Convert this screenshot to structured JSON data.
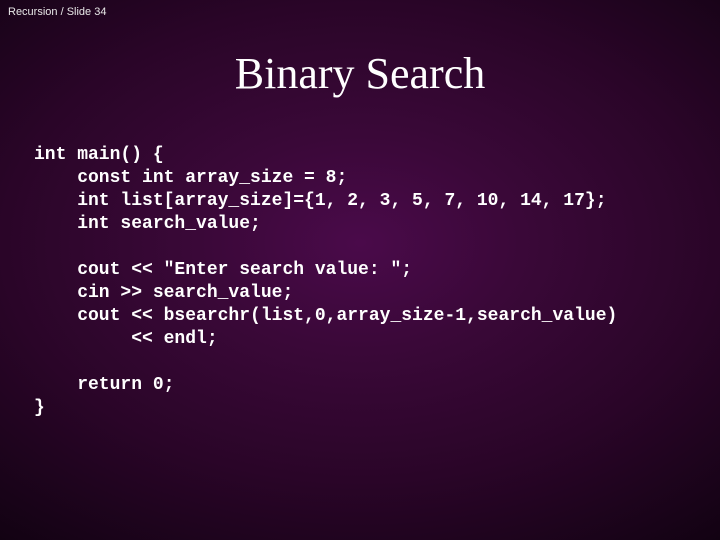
{
  "breadcrumb": "Recursion / Slide 34",
  "title": "Binary Search",
  "code": "int main() {\n    const int array_size = 8;\n    int list[array_size]={1, 2, 3, 5, 7, 10, 14, 17};\n    int search_value;\n\n    cout << \"Enter search value: \";\n    cin >> search_value;\n    cout << bsearchr(list,0,array_size-1,search_value)\n         << endl;\n\n    return 0;\n}"
}
